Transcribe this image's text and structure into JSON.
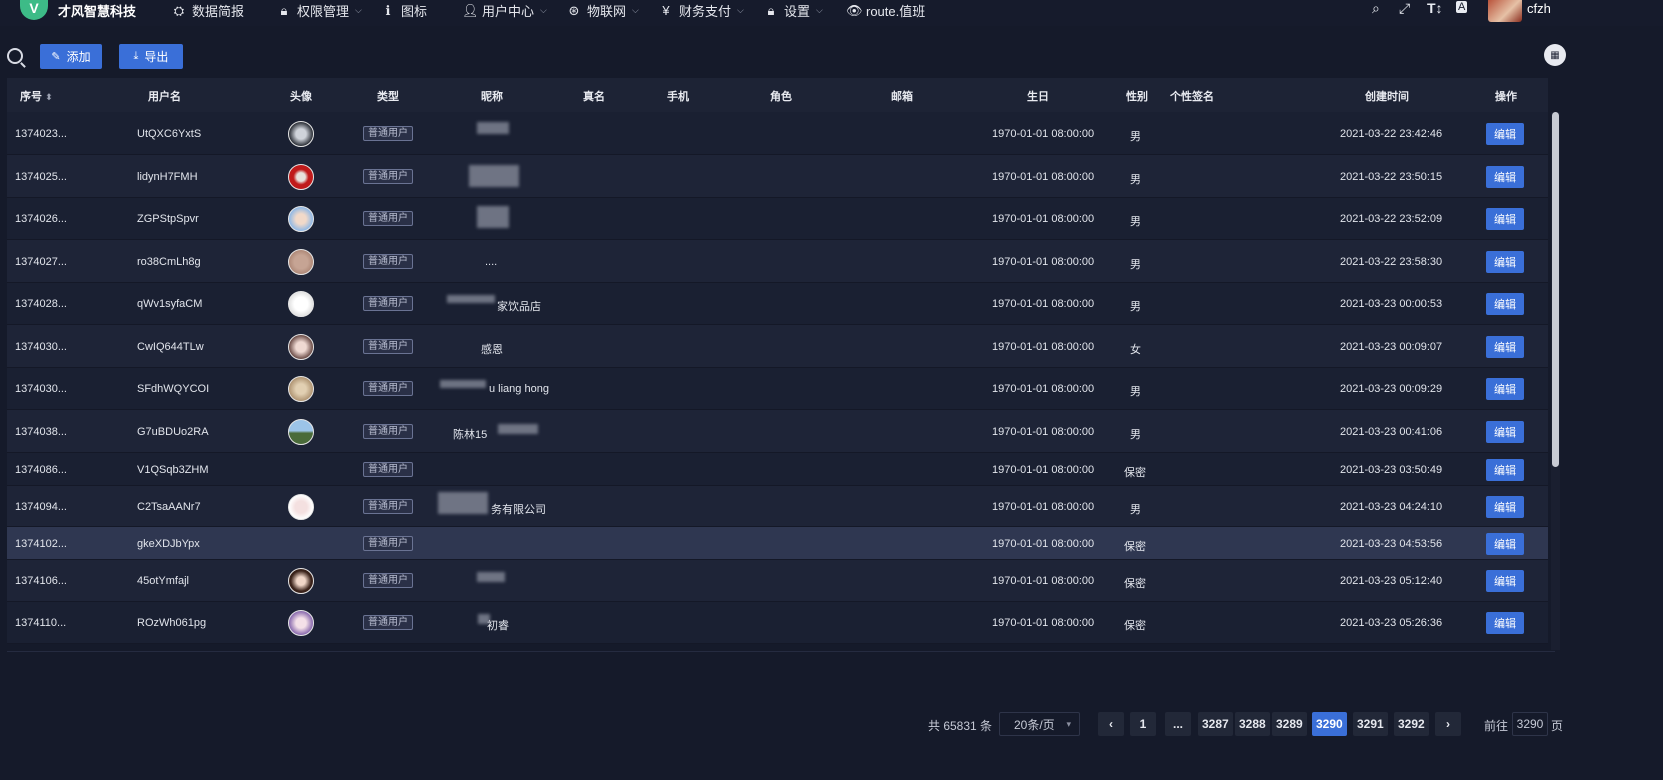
{
  "brand": {
    "logo_letter": "V",
    "name": "才风智慧科技"
  },
  "nav": [
    {
      "label": "数据简报",
      "icon": "dashboard-icon",
      "glyph": "⛭",
      "dropdown": false
    },
    {
      "label": "权限管理",
      "icon": "lock-icon",
      "glyph": "🔒︎",
      "dropdown": true
    },
    {
      "label": "图标",
      "icon": "info-icon",
      "glyph": "ℹ",
      "dropdown": false
    },
    {
      "label": "用户中心",
      "icon": "user-icon",
      "glyph": "👤︎",
      "dropdown": true
    },
    {
      "label": "物联网",
      "icon": "iot-icon",
      "glyph": "⊛",
      "dropdown": true
    },
    {
      "label": "财务支付",
      "icon": "yen-icon",
      "glyph": "¥",
      "dropdown": true
    },
    {
      "label": "设置",
      "icon": "lock-icon",
      "glyph": "🔒︎",
      "dropdown": true
    },
    {
      "label": "route.值班",
      "icon": "eye-icon",
      "glyph": "👁︎",
      "dropdown": false
    }
  ],
  "user": {
    "name": "cfzh"
  },
  "toolbar": {
    "add_label": "添加",
    "export_label": "导出"
  },
  "columns": [
    "序号",
    "用户名",
    "头像",
    "类型",
    "昵称",
    "真名",
    "手机",
    "角色",
    "邮箱",
    "生日",
    "性别",
    "个性签名",
    "创建时间",
    "操作"
  ],
  "rows": [
    {
      "id": "1374023...",
      "username": "UtQXC6YxtS",
      "avatar": true,
      "type": "普通用户",
      "nickname": "",
      "birthday": "1970-01-01 08:00:00",
      "gender": "男",
      "created": "2021-03-22 23:42:46",
      "action": "编辑"
    },
    {
      "id": "1374025...",
      "username": "lidynH7FMH",
      "avatar": true,
      "type": "普通用户",
      "nickname": "",
      "birthday": "1970-01-01 08:00:00",
      "gender": "男",
      "created": "2021-03-22 23:50:15",
      "action": "编辑"
    },
    {
      "id": "1374026...",
      "username": "ZGPStpSpvr",
      "avatar": true,
      "type": "普通用户",
      "nickname": "",
      "birthday": "1970-01-01 08:00:00",
      "gender": "男",
      "created": "2021-03-22 23:52:09",
      "action": "编辑"
    },
    {
      "id": "1374027...",
      "username": "ro38CmLh8g",
      "avatar": true,
      "type": "普通用户",
      "nickname": "....",
      "birthday": "1970-01-01 08:00:00",
      "gender": "男",
      "created": "2021-03-22 23:58:30",
      "action": "编辑"
    },
    {
      "id": "1374028...",
      "username": "qWv1syfaCM",
      "avatar": true,
      "type": "普通用户",
      "nickname": "家饮品店",
      "birthday": "1970-01-01 08:00:00",
      "gender": "男",
      "created": "2021-03-23 00:00:53",
      "action": "编辑"
    },
    {
      "id": "1374030...",
      "username": "CwIQ644TLw",
      "avatar": true,
      "type": "普通用户",
      "nickname": "感恩",
      "birthday": "1970-01-01 08:00:00",
      "gender": "女",
      "created": "2021-03-23 00:09:07",
      "action": "编辑"
    },
    {
      "id": "1374030...",
      "username": "SFdhWQYCOI",
      "avatar": true,
      "type": "普通用户",
      "nickname": "u liang hong",
      "birthday": "1970-01-01 08:00:00",
      "gender": "男",
      "created": "2021-03-23 00:09:29",
      "action": "编辑"
    },
    {
      "id": "1374038...",
      "username": "G7uBDUo2RA",
      "avatar": true,
      "type": "普通用户",
      "nickname": "陈林15",
      "birthday": "1970-01-01 08:00:00",
      "gender": "男",
      "created": "2021-03-23 00:41:06",
      "action": "编辑"
    },
    {
      "id": "1374086...",
      "username": "V1QSqb3ZHM",
      "avatar": false,
      "type": "普通用户",
      "nickname": "",
      "birthday": "1970-01-01 08:00:00",
      "gender": "保密",
      "created": "2021-03-23 03:50:49",
      "action": "编辑"
    },
    {
      "id": "1374094...",
      "username": "C2TsaAANr7",
      "avatar": true,
      "type": "普通用户",
      "nickname": "务有限公司",
      "birthday": "1970-01-01 08:00:00",
      "gender": "男",
      "created": "2021-03-23 04:24:10",
      "action": "编辑"
    },
    {
      "id": "1374102...",
      "username": "gkeXDJbYpx",
      "avatar": false,
      "type": "普通用户",
      "nickname": "",
      "birthday": "1970-01-01 08:00:00",
      "gender": "保密",
      "created": "2021-03-23 04:53:56",
      "action": "编辑"
    },
    {
      "id": "1374106...",
      "username": "45otYmfajl",
      "avatar": true,
      "type": "普通用户",
      "nickname": "",
      "birthday": "1970-01-01 08:00:00",
      "gender": "保密",
      "created": "2021-03-23 05:12:40",
      "action": "编辑"
    },
    {
      "id": "1374110...",
      "username": "ROzWh061pg",
      "avatar": true,
      "type": "普通用户",
      "nickname": "初睿",
      "birthday": "1970-01-01 08:00:00",
      "gender": "保密",
      "created": "2021-03-23 05:26:36",
      "action": "编辑"
    }
  ],
  "highlight_row_index": 10,
  "pagination": {
    "total_text": "共 65831 条",
    "page_size": "20条/页",
    "pages": [
      "1",
      "...",
      "3287",
      "3288",
      "3289",
      "3290",
      "3291",
      "3292"
    ],
    "current": "3290",
    "goto_label": "前往",
    "goto_value": "3290",
    "page_suffix": "页"
  },
  "colors": {
    "accent": "#3a6fd8",
    "background": "#151a2a",
    "header": "#1d2335"
  }
}
